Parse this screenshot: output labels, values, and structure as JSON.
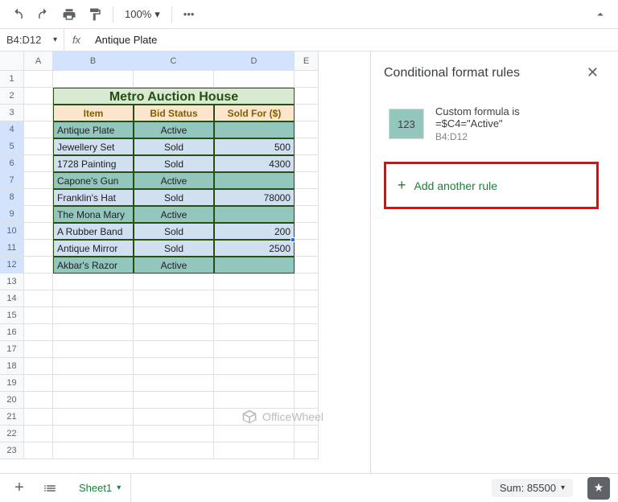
{
  "toolbar": {
    "zoom": "100%"
  },
  "namebox": "B4:D12",
  "formula": "Antique Plate",
  "columns": [
    "A",
    "B",
    "C",
    "D",
    "E"
  ],
  "rows": [
    "1",
    "2",
    "3",
    "4",
    "5",
    "6",
    "7",
    "8",
    "9",
    "10",
    "11",
    "12",
    "13",
    "14",
    "15",
    "16",
    "17",
    "18",
    "19",
    "20",
    "21",
    "22",
    "23"
  ],
  "table": {
    "title": "Metro Auction House",
    "headers": [
      "Item",
      "Bid Status",
      "Sold For ($)"
    ],
    "data": [
      {
        "item": "Antique Plate",
        "status": "Active",
        "sold": ""
      },
      {
        "item": "Jewellery Set",
        "status": "Sold",
        "sold": "500"
      },
      {
        "item": "1728 Painting",
        "status": "Sold",
        "sold": "4300"
      },
      {
        "item": "Capone's Gun",
        "status": "Active",
        "sold": ""
      },
      {
        "item": "Franklin's Hat",
        "status": "Sold",
        "sold": "78000"
      },
      {
        "item": "The Mona Mary",
        "status": "Active",
        "sold": ""
      },
      {
        "item": "A Rubber Band",
        "status": "Sold",
        "sold": "200"
      },
      {
        "item": "Antique Mirror",
        "status": "Sold",
        "sold": "2500"
      },
      {
        "item": "Akbar's Razor",
        "status": "Active",
        "sold": ""
      }
    ]
  },
  "sidepanel": {
    "title": "Conditional format rules",
    "rule": {
      "swatch_label": "123",
      "type": "Custom formula is",
      "formula": "=$C4=\"Active\"",
      "range": "B4:D12"
    },
    "add_label": "Add another rule"
  },
  "bottom": {
    "sheet": "Sheet1",
    "sum": "Sum: 85500"
  },
  "watermark": "OfficeWheel"
}
